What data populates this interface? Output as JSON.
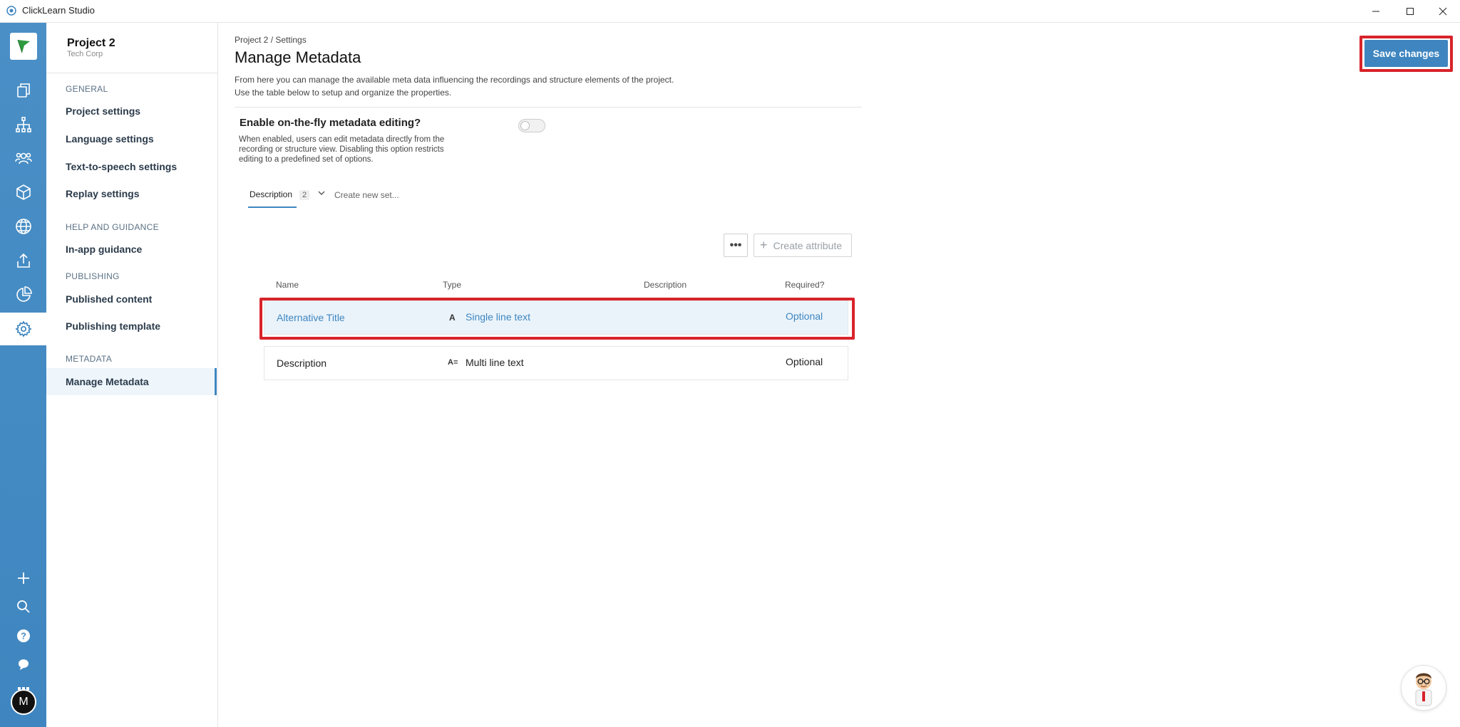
{
  "window": {
    "title": "ClickLearn Studio"
  },
  "nav": {
    "project_name": "Project 2",
    "project_org": "Tech Corp",
    "sections": [
      {
        "heading": "GENERAL",
        "items": [
          "Project settings",
          "Language settings",
          "Text-to-speech settings",
          "Replay settings"
        ]
      },
      {
        "heading": "HELP AND GUIDANCE",
        "items": [
          "In-app guidance"
        ]
      },
      {
        "heading": "PUBLISHING",
        "items": [
          "Published content",
          "Publishing template"
        ]
      },
      {
        "heading": "METADATA",
        "items": [
          "Manage Metadata"
        ]
      }
    ],
    "active_item": "Manage Metadata"
  },
  "main": {
    "breadcrumb": "Project 2 / Settings",
    "title": "Manage Metadata",
    "description_line1": "From here you can manage the available meta data influencing the recordings and structure elements of the project.",
    "description_line2": "Use the table below to setup and organize the properties.",
    "fly": {
      "title": "Enable on-the-fly metadata editing?",
      "desc_line1": "When enabled, users can edit metadata directly from the",
      "desc_line2": "recording or structure view. Disabling this option restricts",
      "desc_line3": "editing to a predefined set of options.",
      "enabled": false
    },
    "tabs": {
      "active_label": "Description",
      "count": "2",
      "create_label": "Create new set..."
    },
    "toolbar": {
      "more_label": "•••",
      "create_label": "Create attribute"
    },
    "table": {
      "headers": {
        "name": "Name",
        "type": "Type",
        "description": "Description",
        "required": "Required?"
      },
      "rows": [
        {
          "name": "Alternative Title",
          "type_glyph": "A",
          "type": "Single line text",
          "description": "",
          "required": "Optional"
        },
        {
          "name": "Description",
          "type_glyph": "A≡",
          "type": "Multi line text",
          "description": "",
          "required": "Optional"
        }
      ]
    },
    "save_label": "Save changes"
  },
  "user": {
    "initial": "M"
  },
  "colors": {
    "accent": "#3f86c0",
    "highlight": "#d8232a",
    "rail": "#4a8fc6"
  }
}
